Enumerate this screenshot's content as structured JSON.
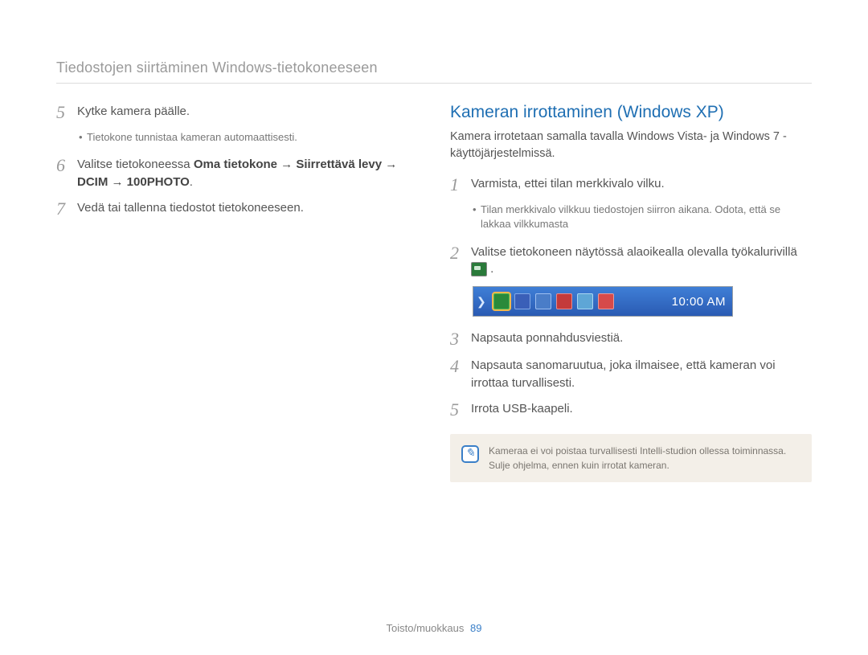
{
  "header": {
    "title": "Tiedostojen siirtäminen Windows-tietokoneeseen"
  },
  "left": {
    "step5": {
      "num": "5",
      "text": "Kytke kamera päälle."
    },
    "step5_sub": "Tietokone tunnistaa kameran automaattisesti.",
    "step6": {
      "num": "6",
      "prefix": "Valitse tietokoneessa ",
      "bold": "Oma tietokone → Siirrettävä levy → DCIM → 100PHOTO",
      "suffix": "."
    },
    "step7": {
      "num": "7",
      "text": "Vedä tai tallenna tiedostot tietokoneeseen."
    }
  },
  "right": {
    "title": "Kameran irrottaminen (Windows XP)",
    "intro": "Kamera irrotetaan samalla tavalla Windows Vista- ja Windows 7 -käyttöjärjestelmissä.",
    "step1": {
      "num": "1",
      "text": "Varmista, ettei tilan merkkivalo vilku."
    },
    "step1_sub": "Tilan merkkivalo vilkkuu tiedostojen siirron aikana. Odota, että se lakkaa vilkkumasta",
    "step2": {
      "num": "2",
      "text_a": "Valitse tietokoneen näytössä alaoikealla olevalla työkalurivillä ",
      "text_b": " ."
    },
    "taskbar": {
      "clock": "10:00 AM",
      "icons": [
        "safely-remove-hardware-icon",
        "device-icon",
        "network-icon",
        "volume-icon",
        "antivirus-icon",
        "alert-icon"
      ]
    },
    "step3": {
      "num": "3",
      "text": "Napsauta ponnahdusviestiä."
    },
    "step4": {
      "num": "4",
      "text": "Napsauta sanomaruutua, joka ilmaisee, että kameran voi irrottaa turvallisesti."
    },
    "step5": {
      "num": "5",
      "text": "Irrota USB-kaapeli."
    },
    "note": "Kameraa ei voi poistaa turvallisesti Intelli-studion ollessa toiminnassa. Sulje ohjelma, ennen kuin irrotat kameran."
  },
  "footer": {
    "section": "Toisto/muokkaus",
    "page": "89"
  }
}
